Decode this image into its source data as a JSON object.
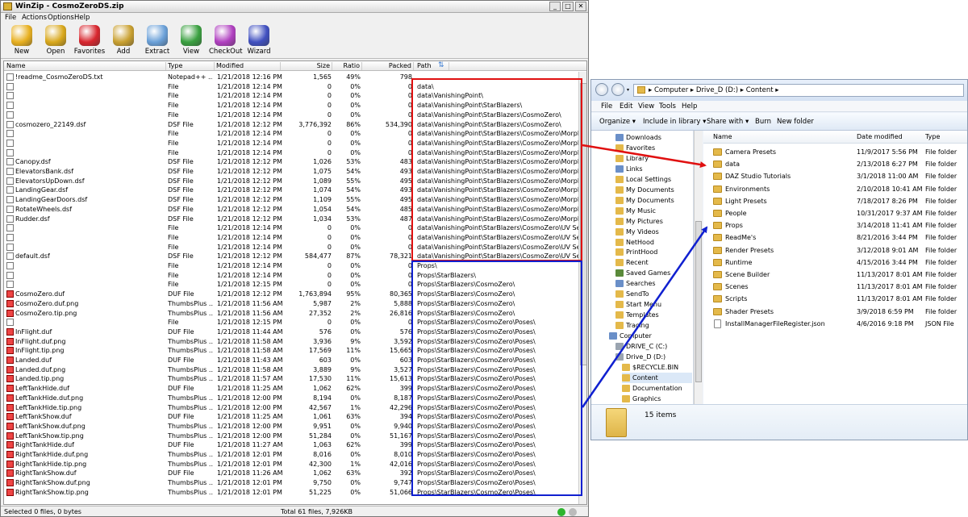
{
  "winzip": {
    "title": "WinZip - CosmoZeroDS.zip",
    "caption_buttons": [
      "_",
      "□",
      "✕"
    ],
    "menu": [
      "File",
      "Actions",
      "Options",
      "Help"
    ],
    "toolbar": [
      {
        "label": "New",
        "icon": "new-archive-icon",
        "color": "#e8b020"
      },
      {
        "label": "Open",
        "icon": "open-archive-icon",
        "color": "#d9a81c"
      },
      {
        "label": "Favorites",
        "icon": "favorites-heart-icon",
        "color": "#d8262e"
      },
      {
        "label": "Add",
        "icon": "add-files-icon",
        "color": "#c9a030"
      },
      {
        "label": "Extract",
        "icon": "extract-files-icon",
        "color": "#6aa0d8"
      },
      {
        "label": "View",
        "icon": "view-glasses-icon",
        "color": "#3aa040"
      },
      {
        "label": "CheckOut",
        "icon": "checkout-icon",
        "color": "#b040c0"
      },
      {
        "label": "Wizard",
        "icon": "wizard-icon",
        "color": "#4050c0"
      }
    ],
    "columns": [
      "Name",
      "Type",
      "Modified",
      "Size",
      "Ratio",
      "Packed",
      "Path"
    ],
    "rows": [
      [
        "!readme_CosmoZeroDS.txt",
        "Notepad++ ...",
        "1/21/2018 12:16 PM",
        "1,565",
        "49%",
        "798",
        ""
      ],
      [
        "",
        "File",
        "1/21/2018 12:14 PM",
        "0",
        "0%",
        "0",
        "data\\"
      ],
      [
        "",
        "File",
        "1/21/2018 12:14 PM",
        "0",
        "0%",
        "0",
        "data\\VanishingPoint\\"
      ],
      [
        "",
        "File",
        "1/21/2018 12:14 PM",
        "0",
        "0%",
        "0",
        "data\\VanishingPoint\\StarBlazers\\"
      ],
      [
        "",
        "File",
        "1/21/2018 12:14 PM",
        "0",
        "0%",
        "0",
        "data\\VanishingPoint\\StarBlazers\\CosmoZero\\"
      ],
      [
        "cosmozero_22149.dsf",
        "DSF File",
        "1/21/2018 12:12 PM",
        "3,776,392",
        "86%",
        "534,390",
        "data\\VanishingPoint\\StarBlazers\\CosmoZero\\"
      ],
      [
        "",
        "File",
        "1/21/2018 12:14 PM",
        "0",
        "0%",
        "0",
        "data\\VanishingPoint\\StarBlazers\\CosmoZero\\Morphs\\"
      ],
      [
        "",
        "File",
        "1/21/2018 12:14 PM",
        "0",
        "0%",
        "0",
        "data\\VanishingPoint\\StarBlazers\\CosmoZero\\Morphs\\Vanishin"
      ],
      [
        "",
        "File",
        "1/21/2018 12:14 PM",
        "0",
        "0%",
        "0",
        "data\\VanishingPoint\\StarBlazers\\CosmoZero\\Morphs\\Vanishin"
      ],
      [
        "Canopy.dsf",
        "DSF File",
        "1/21/2018 12:12 PM",
        "1,026",
        "53%",
        "483",
        "data\\VanishingPoint\\StarBlazers\\CosmoZero\\Morphs\\Vanishin"
      ],
      [
        "ElevatorsBank.dsf",
        "DSF File",
        "1/21/2018 12:12 PM",
        "1,075",
        "54%",
        "493",
        "data\\VanishingPoint\\StarBlazers\\CosmoZero\\Morphs\\Vanishin"
      ],
      [
        "ElevatorsUpDown.dsf",
        "DSF File",
        "1/21/2018 12:12 PM",
        "1,089",
        "55%",
        "495",
        "data\\VanishingPoint\\StarBlazers\\CosmoZero\\Morphs\\Vanishin"
      ],
      [
        "LandingGear.dsf",
        "DSF File",
        "1/21/2018 12:12 PM",
        "1,074",
        "54%",
        "493",
        "data\\VanishingPoint\\StarBlazers\\CosmoZero\\Morphs\\Vanishin"
      ],
      [
        "LandingGearDoors.dsf",
        "DSF File",
        "1/21/2018 12:12 PM",
        "1,109",
        "55%",
        "495",
        "data\\VanishingPoint\\StarBlazers\\CosmoZero\\Morphs\\Vanishin"
      ],
      [
        "RotateWheels.dsf",
        "DSF File",
        "1/21/2018 12:12 PM",
        "1,054",
        "54%",
        "485",
        "data\\VanishingPoint\\StarBlazers\\CosmoZero\\Morphs\\Vanishin"
      ],
      [
        "Rudder.dsf",
        "DSF File",
        "1/21/2018 12:12 PM",
        "1,034",
        "53%",
        "487",
        "data\\VanishingPoint\\StarBlazers\\CosmoZero\\Morphs\\Vanishin"
      ],
      [
        "",
        "File",
        "1/21/2018 12:14 PM",
        "0",
        "0%",
        "0",
        "data\\VanishingPoint\\StarBlazers\\CosmoZero\\UV Sets\\"
      ],
      [
        "",
        "File",
        "1/21/2018 12:14 PM",
        "0",
        "0%",
        "0",
        "data\\VanishingPoint\\StarBlazers\\CosmoZero\\UV Sets\\Vanishi"
      ],
      [
        "",
        "File",
        "1/21/2018 12:14 PM",
        "0",
        "0%",
        "0",
        "data\\VanishingPoint\\StarBlazers\\CosmoZero\\UV Sets\\Vanishi"
      ],
      [
        "default.dsf",
        "DSF File",
        "1/21/2018 12:12 PM",
        "584,477",
        "87%",
        "78,321",
        "data\\VanishingPoint\\StarBlazers\\CosmoZero\\UV Sets\\Vanishi"
      ],
      [
        "",
        "File",
        "1/21/2018 12:14 PM",
        "0",
        "0%",
        "0",
        "Props\\"
      ],
      [
        "",
        "File",
        "1/21/2018 12:14 PM",
        "0",
        "0%",
        "0",
        "Props\\StarBlazers\\"
      ],
      [
        "",
        "File",
        "1/21/2018 12:15 PM",
        "0",
        "0%",
        "0",
        "Props\\StarBlazers\\CosmoZero\\"
      ],
      [
        "CosmoZero.duf",
        "DUF File",
        "1/21/2018 12:12 PM",
        "1,763,894",
        "95%",
        "80,365",
        "Props\\StarBlazers\\CosmoZero\\"
      ],
      [
        "CosmoZero.duf.png",
        "ThumbsPlus ...",
        "1/21/2018 11:56 AM",
        "5,987",
        "2%",
        "5,888",
        "Props\\StarBlazers\\CosmoZero\\"
      ],
      [
        "CosmoZero.tip.png",
        "ThumbsPlus ...",
        "1/21/2018 11:56 AM",
        "27,352",
        "2%",
        "26,816",
        "Props\\StarBlazers\\CosmoZero\\"
      ],
      [
        "",
        "File",
        "1/21/2018 12:15 PM",
        "0",
        "0%",
        "0",
        "Props\\StarBlazers\\CosmoZero\\Poses\\"
      ],
      [
        "InFlight.duf",
        "DUF File",
        "1/21/2018 11:44 AM",
        "576",
        "0%",
        "576",
        "Props\\StarBlazers\\CosmoZero\\Poses\\"
      ],
      [
        "InFlight.duf.png",
        "ThumbsPlus ...",
        "1/21/2018 11:58 AM",
        "3,936",
        "9%",
        "3,592",
        "Props\\StarBlazers\\CosmoZero\\Poses\\"
      ],
      [
        "InFlight.tip.png",
        "ThumbsPlus ...",
        "1/21/2018 11:58 AM",
        "17,569",
        "11%",
        "15,665",
        "Props\\StarBlazers\\CosmoZero\\Poses\\"
      ],
      [
        "Landed.duf",
        "DUF File",
        "1/21/2018 11:43 AM",
        "603",
        "0%",
        "603",
        "Props\\StarBlazers\\CosmoZero\\Poses\\"
      ],
      [
        "Landed.duf.png",
        "ThumbsPlus ...",
        "1/21/2018 11:58 AM",
        "3,889",
        "9%",
        "3,527",
        "Props\\StarBlazers\\CosmoZero\\Poses\\"
      ],
      [
        "Landed.tip.png",
        "ThumbsPlus ...",
        "1/21/2018 11:57 AM",
        "17,530",
        "11%",
        "15,613",
        "Props\\StarBlazers\\CosmoZero\\Poses\\"
      ],
      [
        "LeftTankHide.duf",
        "DUF File",
        "1/21/2018 11:25 AM",
        "1,062",
        "62%",
        "399",
        "Props\\StarBlazers\\CosmoZero\\Poses\\"
      ],
      [
        "LeftTankHide.duf.png",
        "ThumbsPlus ...",
        "1/21/2018 12:00 PM",
        "8,194",
        "0%",
        "8,187",
        "Props\\StarBlazers\\CosmoZero\\Poses\\"
      ],
      [
        "LeftTankHide.tip.png",
        "ThumbsPlus ...",
        "1/21/2018 12:00 PM",
        "42,567",
        "1%",
        "42,296",
        "Props\\StarBlazers\\CosmoZero\\Poses\\"
      ],
      [
        "LeftTankShow.duf",
        "DUF File",
        "1/21/2018 11:25 AM",
        "1,061",
        "63%",
        "394",
        "Props\\StarBlazers\\CosmoZero\\Poses\\"
      ],
      [
        "LeftTankShow.duf.png",
        "ThumbsPlus ...",
        "1/21/2018 12:00 PM",
        "9,951",
        "0%",
        "9,940",
        "Props\\StarBlazers\\CosmoZero\\Poses\\"
      ],
      [
        "LeftTankShow.tip.png",
        "ThumbsPlus ...",
        "1/21/2018 12:00 PM",
        "51,284",
        "0%",
        "51,167",
        "Props\\StarBlazers\\CosmoZero\\Poses\\"
      ],
      [
        "RightTankHide.duf",
        "DUF File",
        "1/21/2018 11:27 AM",
        "1,063",
        "62%",
        "399",
        "Props\\StarBlazers\\CosmoZero\\Poses\\"
      ],
      [
        "RightTankHide.duf.png",
        "ThumbsPlus ...",
        "1/21/2018 12:01 PM",
        "8,016",
        "0%",
        "8,010",
        "Props\\StarBlazers\\CosmoZero\\Poses\\"
      ],
      [
        "RightTankHide.tip.png",
        "ThumbsPlus ...",
        "1/21/2018 12:01 PM",
        "42,300",
        "1%",
        "42,016",
        "Props\\StarBlazers\\CosmoZero\\Poses\\"
      ],
      [
        "RightTankShow.duf",
        "DUF File",
        "1/21/2018 11:26 AM",
        "1,062",
        "63%",
        "392",
        "Props\\StarBlazers\\CosmoZero\\Poses\\"
      ],
      [
        "RightTankShow.duf.png",
        "ThumbsPlus ...",
        "1/21/2018 12:01 PM",
        "9,750",
        "0%",
        "9,747",
        "Props\\StarBlazers\\CosmoZero\\Poses\\"
      ],
      [
        "RightTankShow.tip.png",
        "ThumbsPlus ...",
        "1/21/2018 12:01 PM",
        "51,225",
        "0%",
        "51,066",
        "Props\\StarBlazers\\CosmoZero\\Poses\\"
      ]
    ],
    "status_selected": "Selected 0 files, 0 bytes",
    "status_total": "Total 61 files, 7,926KB"
  },
  "explorer": {
    "address": "▸ Computer ▸ Drive_D (D:) ▸ Content ▸",
    "menu": [
      "File",
      "Edit",
      "View",
      "Tools",
      "Help"
    ],
    "commands": [
      "Organize ▾",
      "Include in library ▾",
      "Share with ▾",
      "Burn",
      "New folder"
    ],
    "nav": [
      {
        "label": "Downloads",
        "indent": 1,
        "color": "#6a8fc8"
      },
      {
        "label": "Favorites",
        "indent": 1,
        "color": "#e4b94a"
      },
      {
        "label": "Library",
        "indent": 1,
        "color": "#e4b94a"
      },
      {
        "label": "Links",
        "indent": 1,
        "color": "#6a8fc8"
      },
      {
        "label": "Local Settings",
        "indent": 1,
        "color": "#e4b94a"
      },
      {
        "label": "My Documents",
        "indent": 1,
        "color": "#e4b94a"
      },
      {
        "label": "My Documents",
        "indent": 1,
        "color": "#e4b94a"
      },
      {
        "label": "My Music",
        "indent": 1,
        "color": "#e4b94a"
      },
      {
        "label": "My Pictures",
        "indent": 1,
        "color": "#e4b94a"
      },
      {
        "label": "My Videos",
        "indent": 1,
        "color": "#e4b94a"
      },
      {
        "label": "NetHood",
        "indent": 1,
        "color": "#e4b94a"
      },
      {
        "label": "PrintHood",
        "indent": 1,
        "color": "#e4b94a"
      },
      {
        "label": "Recent",
        "indent": 1,
        "color": "#e4b94a"
      },
      {
        "label": "Saved Games",
        "indent": 1,
        "color": "#5a8a3a"
      },
      {
        "label": "Searches",
        "indent": 1,
        "color": "#6a8fc8"
      },
      {
        "label": "SendTo",
        "indent": 1,
        "color": "#e4b94a"
      },
      {
        "label": "Start Menu",
        "indent": 1,
        "color": "#e4b94a"
      },
      {
        "label": "Templates",
        "indent": 1,
        "color": "#e4b94a"
      },
      {
        "label": "Tracing",
        "indent": 1,
        "color": "#e4b94a"
      },
      {
        "label": "Computer",
        "indent": 0,
        "color": "#6a8fc8"
      },
      {
        "label": "DRIVE_C (C:)",
        "indent": 1,
        "color": "#9aa4b0"
      },
      {
        "label": "Drive_D (D:)",
        "indent": 1,
        "color": "#9aa4b0"
      },
      {
        "label": "$RECYCLE.BIN",
        "indent": 2,
        "color": "#e4b94a"
      },
      {
        "label": "Content",
        "indent": 2,
        "color": "#e4b94a",
        "selected": true
      },
      {
        "label": "Documentation",
        "indent": 2,
        "color": "#e4b94a"
      },
      {
        "label": "Graphics",
        "indent": 2,
        "color": "#e4b94a"
      }
    ],
    "columns": [
      "Name",
      "Date modified",
      "Type"
    ],
    "files": [
      [
        "Camera Presets",
        "11/9/2017 5:56 PM",
        "File folder"
      ],
      [
        "data",
        "2/13/2018 6:27 PM",
        "File folder"
      ],
      [
        "DAZ Studio Tutorials",
        "3/1/2018 11:00 AM",
        "File folder"
      ],
      [
        "Environments",
        "2/10/2018 10:41 AM",
        "File folder"
      ],
      [
        "Light Presets",
        "7/18/2017 8:26 PM",
        "File folder"
      ],
      [
        "People",
        "10/31/2017 9:37 AM",
        "File folder"
      ],
      [
        "Props",
        "3/14/2018 11:41 AM",
        "File folder"
      ],
      [
        "ReadMe's",
        "8/21/2016 3:44 PM",
        "File folder"
      ],
      [
        "Render Presets",
        "3/12/2018 9:01 AM",
        "File folder"
      ],
      [
        "Runtime",
        "4/15/2016 3:44 PM",
        "File folder"
      ],
      [
        "Scene Builder",
        "11/13/2017 8:01 AM",
        "File folder"
      ],
      [
        "Scenes",
        "11/13/2017 8:01 AM",
        "File folder"
      ],
      [
        "Scripts",
        "11/13/2017 8:01 AM",
        "File folder"
      ],
      [
        "Shader Presets",
        "3/9/2018 6:59 PM",
        "File folder"
      ],
      [
        "InstallManagerFileRegister.json",
        "4/6/2016 9:18 PM",
        "JSON File"
      ]
    ],
    "item_count": "15 items"
  },
  "annotations": {
    "red": "#e01010",
    "blue": "#1020d0"
  }
}
